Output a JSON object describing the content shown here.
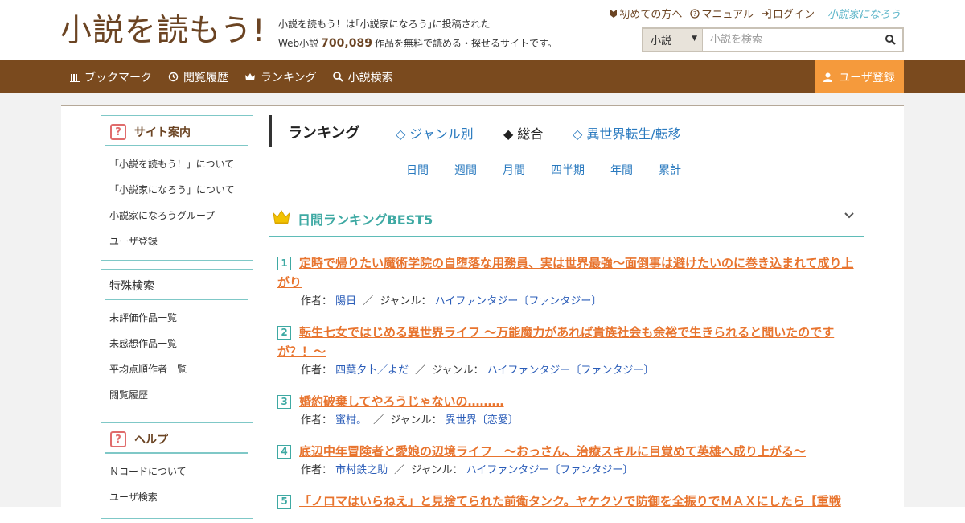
{
  "header": {
    "logo": "小説を読もう!",
    "tagline_line1": "小説を読もう！は｢小説家になろう｣に投稿された",
    "tagline_prefix": "Web小説",
    "work_count": "700,089",
    "tagline_suffix": "作品を無料で読める・探せるサイトです。",
    "links": [
      {
        "icon": "beginner-mark-icon",
        "label": "初めての方へ"
      },
      {
        "icon": "question-circle-icon",
        "label": "マニュアル"
      },
      {
        "icon": "login-icon",
        "label": "ログイン"
      }
    ],
    "partner_logo": "小説家になろう",
    "search": {
      "category": "小説",
      "placeholder": "小説を検索"
    }
  },
  "nav": {
    "items": [
      {
        "icon": "bookshelf-icon",
        "label": "ブックマーク"
      },
      {
        "icon": "history-icon",
        "label": "閲覧履歴"
      },
      {
        "icon": "crown-icon",
        "label": "ランキング"
      },
      {
        "icon": "search-icon",
        "label": "小説検索"
      }
    ],
    "register": "ユーザ登録"
  },
  "sidebar": {
    "site_guide": {
      "title": "サイト案内",
      "items": [
        "「小説を読もう！」について",
        "「小説家になろう」について",
        "小説家になろうグループ",
        "ユーザ登録"
      ]
    },
    "special_search": {
      "title": "特殊検索",
      "items": [
        "未評価作品一覧",
        "未感想作品一覧",
        "平均点順作者一覧",
        "閲覧履歴"
      ]
    },
    "help": {
      "title": "ヘルプ",
      "items": [
        "Ｎコードについて",
        "ユーザ検索"
      ]
    }
  },
  "ranking": {
    "title": "ランキング",
    "tabs": [
      {
        "label": "◇ ジャンル別",
        "active": false
      },
      {
        "label": "◆ 総合",
        "active": true
      },
      {
        "label": "◇ 異世界転生/転移",
        "active": false
      }
    ],
    "periods": [
      "日間",
      "週間",
      "月間",
      "四半期",
      "年間",
      "累計"
    ],
    "best_title": "日間ランキングBEST5",
    "author_label": "作者：",
    "genre_label": "ジャンル：",
    "entries": [
      {
        "rank": "1",
        "title": "定時で帰りたい魔術学院の自堕落な用務員、実は世界最強～面倒事は避けたいのに巻き込まれて成り上がり",
        "author": "陽日",
        "genre": "ハイファンタジー〔ファンタジー〕"
      },
      {
        "rank": "2",
        "title": "転生七女ではじめる異世界ライフ 〜万能魔力があれば貴族社会も余裕で生きられると聞いたのですが？！〜",
        "author": "四葉夕卜／よだ",
        "genre": "ハイファンタジー〔ファンタジー〕"
      },
      {
        "rank": "3",
        "title": "婚約破棄してやろうじゃないの………",
        "author": "蜜柑。",
        "genre": "異世界〔恋愛〕"
      },
      {
        "rank": "4",
        "title": "底辺中年冒険者と愛娘の辺境ライフ　〜おっさん、治療スキルに目覚めて英雄へ成り上がる〜",
        "author": "市村鉄之助",
        "genre": "ハイファンタジー〔ファンタジー〕"
      },
      {
        "rank": "5",
        "title": "「ノロマはいらねえ」と見捨てられた前衛タンク。ヤケクソで防御を全振りでＭＡＸにしたら【重戦",
        "author": "",
        "genre": ""
      }
    ]
  },
  "colors": {
    "brand_brown": "#7a4a1e",
    "accent_orange": "#f59a3c",
    "teal": "#3ea9a3",
    "title_orange": "#e8742e",
    "link_blue": "#2a7abf"
  }
}
